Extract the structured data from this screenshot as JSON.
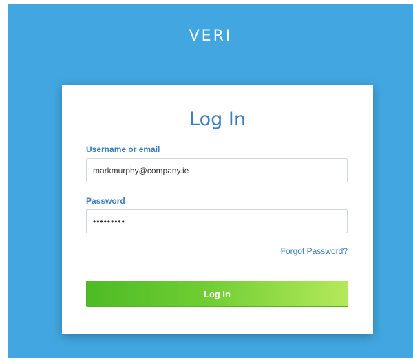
{
  "app": {
    "brand": "VERI"
  },
  "login_form": {
    "title": "Log In",
    "username_label": "Username or email",
    "username_value": "markmurphy@company.ie",
    "password_label": "Password",
    "password_value": "•••••••••",
    "forgot_link": "Forgot Password?",
    "submit_label": "Log In"
  },
  "colors": {
    "background": "#42a7e0",
    "accent_text": "#3d7fc1",
    "button_start": "#4dbb24",
    "button_end": "#b4e95a"
  }
}
